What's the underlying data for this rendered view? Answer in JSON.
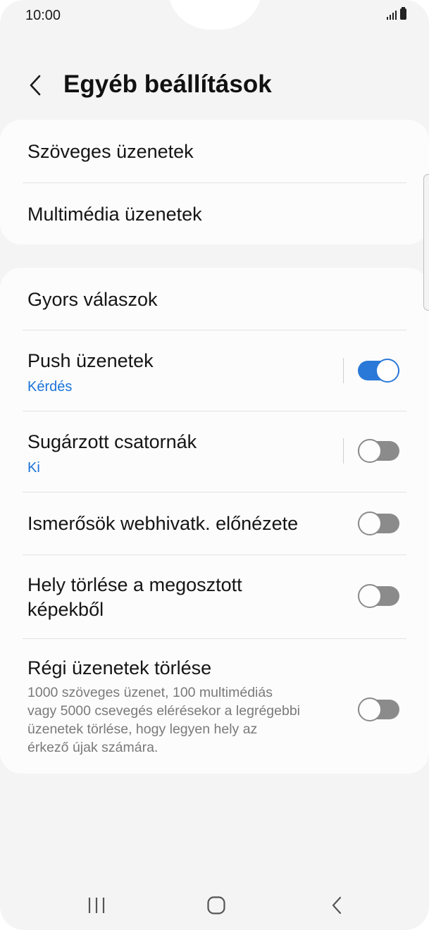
{
  "status_bar": {
    "time": "10:00"
  },
  "header": {
    "title": "Egyéb beállítások"
  },
  "group1": {
    "items": [
      {
        "title": "Szöveges üzenetek"
      },
      {
        "title": "Multimédia üzenetek"
      }
    ]
  },
  "group2": {
    "gyors": {
      "title": "Gyors válaszok"
    },
    "push": {
      "title": "Push üzenetek",
      "subtitle": "Kérdés",
      "enabled": true
    },
    "broadcast": {
      "title": "Sugárzott csatornák",
      "subtitle": "Ki",
      "enabled": false
    },
    "preview": {
      "title": "Ismerősök webhivatk. előnézete",
      "enabled": false
    },
    "location": {
      "title_line1": "Hely törlése a megosztott",
      "title_line2": "képekből",
      "enabled": false
    },
    "old": {
      "title": "Régi üzenetek törlése",
      "desc_line1": "1000 szöveges üzenet, 100 multimédiás",
      "desc_line2": "vagy 5000 csevegés elérésekor a legrégebbi",
      "desc_line3": "üzenetek törlése, hogy legyen hely az",
      "desc_line4": "érkező újak számára.",
      "enabled": false
    }
  },
  "colors": {
    "accent": "#2a79d8",
    "toggle_off": "#8b8b8b",
    "background": "#f4f4f4",
    "card": "#fcfcfc"
  },
  "icons": {
    "back": "chevron-left-icon",
    "nav_recent": "recent-apps-icon",
    "nav_home": "home-icon",
    "nav_back": "back-icon"
  }
}
